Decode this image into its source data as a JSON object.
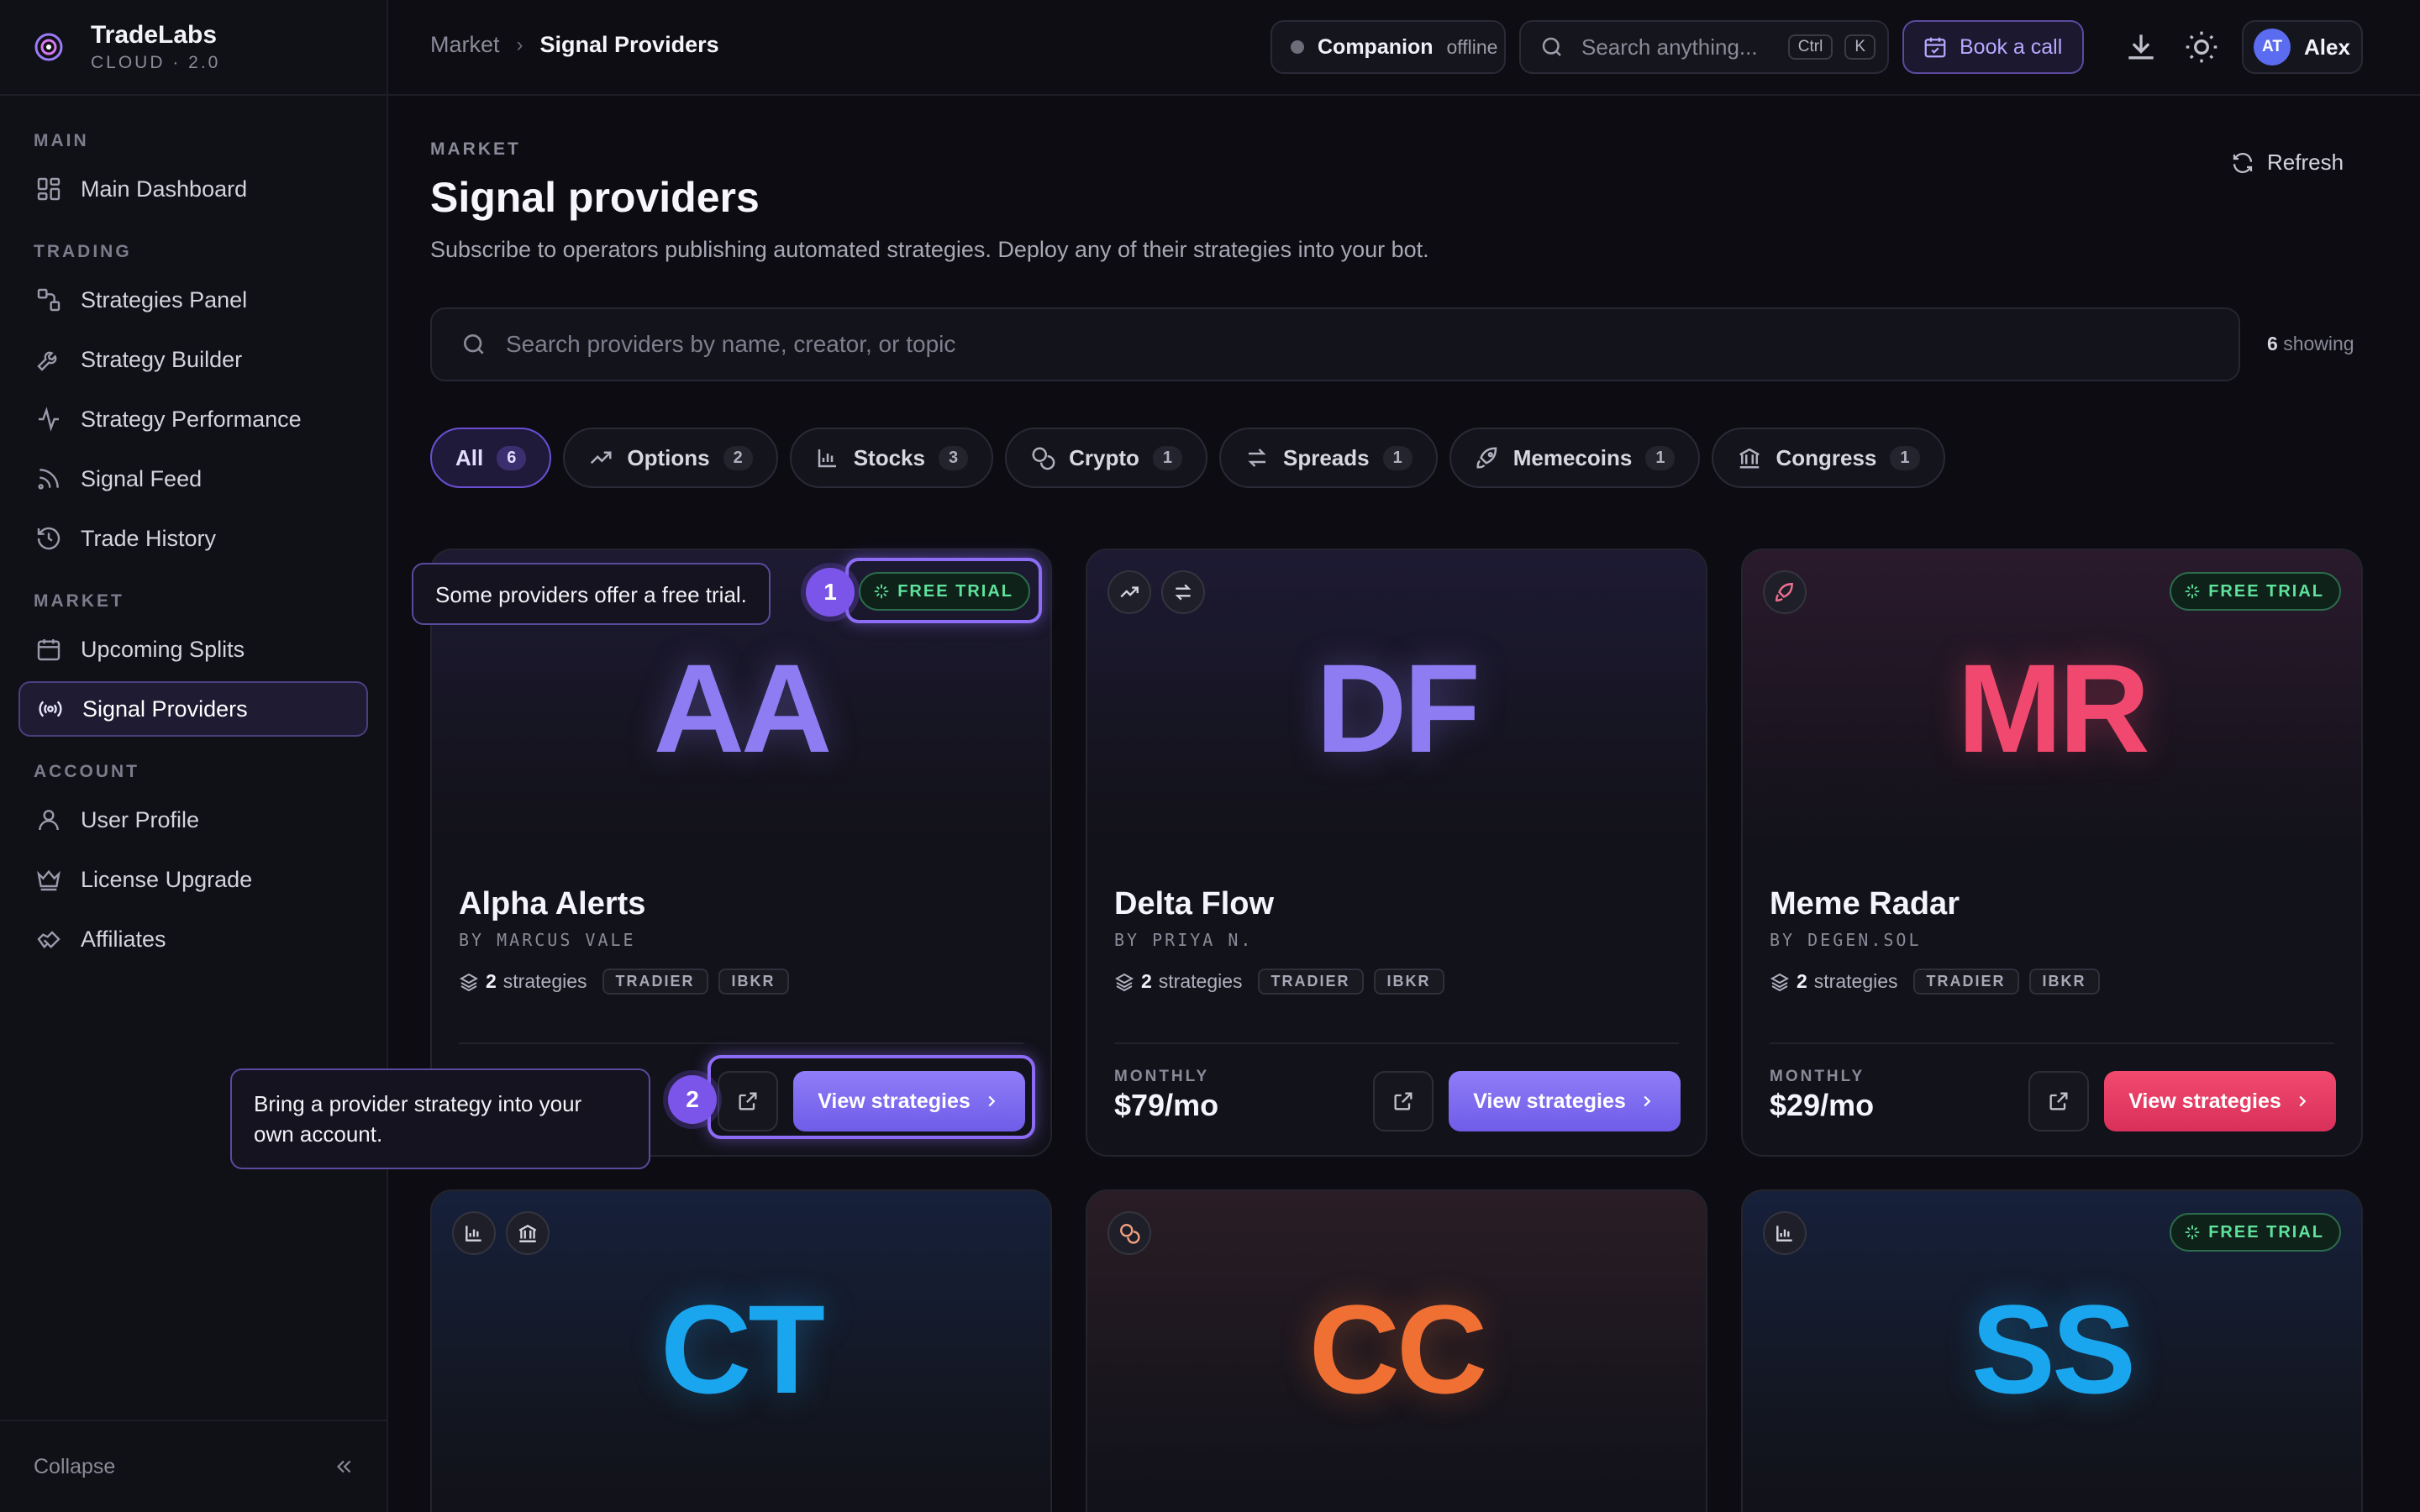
{
  "brand": {
    "name": "TradeLabs",
    "sub": "CLOUD · 2.0"
  },
  "sidebar": {
    "sections": [
      {
        "label": "MAIN",
        "items": [
          {
            "label": "Main Dashboard",
            "icon": "dashboard-icon"
          }
        ]
      },
      {
        "label": "TRADING",
        "items": [
          {
            "label": "Strategies Panel",
            "icon": "strategies-icon"
          },
          {
            "label": "Strategy Builder",
            "icon": "wrench-icon"
          },
          {
            "label": "Strategy Performance",
            "icon": "pulse-icon"
          },
          {
            "label": "Signal Feed",
            "icon": "rss-icon"
          },
          {
            "label": "Trade History",
            "icon": "history-icon"
          }
        ]
      },
      {
        "label": "MARKET",
        "items": [
          {
            "label": "Upcoming Splits",
            "icon": "calendar-icon"
          },
          {
            "label": "Signal Providers",
            "icon": "broadcast-icon",
            "active": true
          }
        ]
      },
      {
        "label": "ACCOUNT",
        "items": [
          {
            "label": "User Profile",
            "icon": "user-icon"
          },
          {
            "label": "License Upgrade",
            "icon": "crown-icon"
          },
          {
            "label": "Affiliates",
            "icon": "handshake-icon"
          }
        ]
      }
    ],
    "collapse_label": "Collapse"
  },
  "topbar": {
    "breadcrumb": [
      "Market",
      "Signal Providers"
    ],
    "companion": {
      "name": "Companion",
      "state": "offline"
    },
    "search_placeholder": "Search anything...",
    "shortcut": [
      "Ctrl",
      "K"
    ],
    "book_call": "Book a call",
    "user": {
      "initials": "AT",
      "name": "Alex"
    }
  },
  "page": {
    "eyebrow": "MARKET",
    "title": "Signal providers",
    "subtitle": "Subscribe to operators publishing automated strategies. Deploy any of their strategies into your bot.",
    "refresh": "Refresh",
    "search_placeholder": "Search providers by name, creator, or topic",
    "showing_count": "6",
    "showing_label": "showing"
  },
  "filters": [
    {
      "label": "All",
      "count": "6",
      "active": true
    },
    {
      "label": "Options",
      "count": "2",
      "icon": "trend-up-icon"
    },
    {
      "label": "Stocks",
      "count": "3",
      "icon": "bar-chart-icon"
    },
    {
      "label": "Crypto",
      "count": "1",
      "icon": "coins-icon"
    },
    {
      "label": "Spreads",
      "count": "1",
      "icon": "arrows-icon"
    },
    {
      "label": "Memecoins",
      "count": "1",
      "icon": "rocket-icon"
    },
    {
      "label": "Congress",
      "count": "1",
      "icon": "bank-icon"
    }
  ],
  "labels": {
    "free_trial": "FREE TRIAL",
    "strategies": "strategies",
    "monthly": "MONTHLY",
    "view_strategies": "View strategies"
  },
  "providers": [
    {
      "initials": "AA",
      "name": "Alpha Alerts",
      "by": "BY MARCUS VALE",
      "strategies": "2",
      "brokers": [
        "TRADIER",
        "IBKR"
      ],
      "free_trial": true,
      "color": "#8d7cf2"
    },
    {
      "initials": "DF",
      "name": "Delta Flow",
      "by": "BY PRIYA N.",
      "strategies": "2",
      "brokers": [
        "TRADIER",
        "IBKR"
      ],
      "price": "$79/mo",
      "color": "#8d7cf2"
    },
    {
      "initials": "MR",
      "name": "Meme Radar",
      "by": "BY DEGEN.SOL",
      "strategies": "2",
      "brokers": [
        "TRADIER",
        "IBKR"
      ],
      "price": "$29/mo",
      "free_trial": true,
      "color": "#f0486e"
    },
    {
      "initials": "CT",
      "color": "#1aa6ee"
    },
    {
      "initials": "CC",
      "color": "#f07034"
    },
    {
      "initials": "SS",
      "free_trial": true,
      "color": "#1aa6ee"
    }
  ],
  "tour": [
    {
      "step": "1",
      "text": "Some providers offer a free trial."
    },
    {
      "step": "2",
      "text": "Bring a provider strategy into your own account."
    }
  ]
}
